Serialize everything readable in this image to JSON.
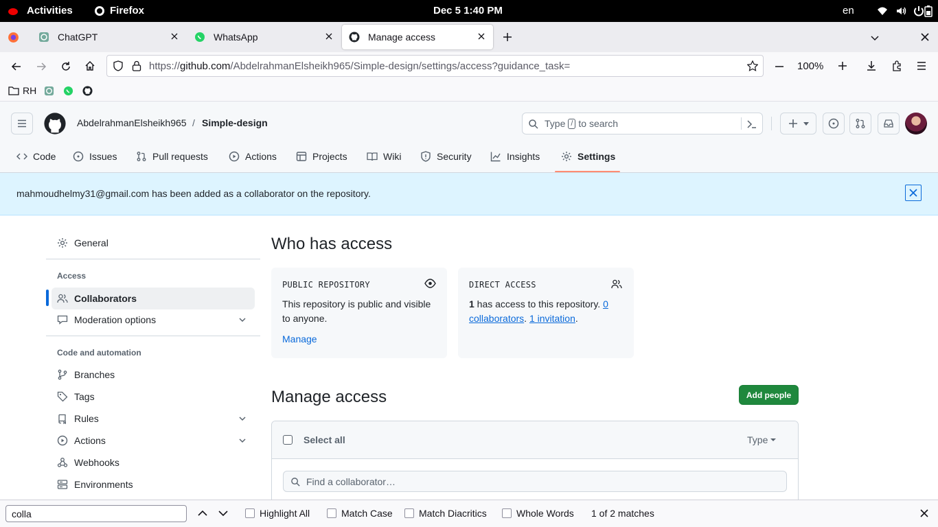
{
  "system": {
    "activities": "Activities",
    "app": "Firefox",
    "datetime": "Dec 5  1:40 PM",
    "lang": "en"
  },
  "browser": {
    "tabs": [
      {
        "label": "ChatGPT"
      },
      {
        "label": "WhatsApp"
      },
      {
        "label": "Manage access"
      }
    ],
    "url_prefix": "https://",
    "url_domain": "github.com",
    "url_path": "/AbdelrahmanElsheikh965/Simple-design/settings/access?guidance_task=",
    "zoom": "100%",
    "bookmarks": [
      {
        "label": "RH"
      }
    ]
  },
  "github": {
    "owner": "AbdelrahmanElsheikh965",
    "separator": "/",
    "repo": "Simple-design",
    "search_prefix": "Type",
    "search_key": "/",
    "search_suffix": "to search",
    "nav": [
      "Code",
      "Issues",
      "Pull requests",
      "Actions",
      "Projects",
      "Wiki",
      "Security",
      "Insights",
      "Settings"
    ],
    "accent": "#fd8c73"
  },
  "flash": {
    "message": "mahmoudhelmy31@gmail.com has been added as a collaborator on the repository."
  },
  "sidebar": {
    "general": "General",
    "access_heading": "Access",
    "collaborators": "Collaborators",
    "moderation": "Moderation options",
    "code_heading": "Code and automation",
    "items": [
      "Branches",
      "Tags",
      "Rules",
      "Actions",
      "Webhooks",
      "Environments"
    ]
  },
  "main": {
    "title": "Who has access",
    "public_box": {
      "label": "PUBLIC REPOSITORY",
      "text": "This repository is public and visible to anyone.",
      "manage": "Manage"
    },
    "direct_box": {
      "label": "DIRECT ACCESS",
      "count": "1",
      "text": " has access to this repository. ",
      "collab_link": "0 collaborators",
      "sep": ". ",
      "invite_link": "1 invitation",
      "end": "."
    },
    "manage_title": "Manage access",
    "add_people": "Add people",
    "select_all": "Select all",
    "type_filter": "Type",
    "find_placeholder": "Find a collaborator…"
  },
  "findbar": {
    "query": "colla",
    "highlight_all": "Highlight All",
    "match_case": "Match Case",
    "match_diacritics": "Match Diacritics",
    "whole_words": "Whole Words",
    "status": "1 of 2 matches"
  }
}
